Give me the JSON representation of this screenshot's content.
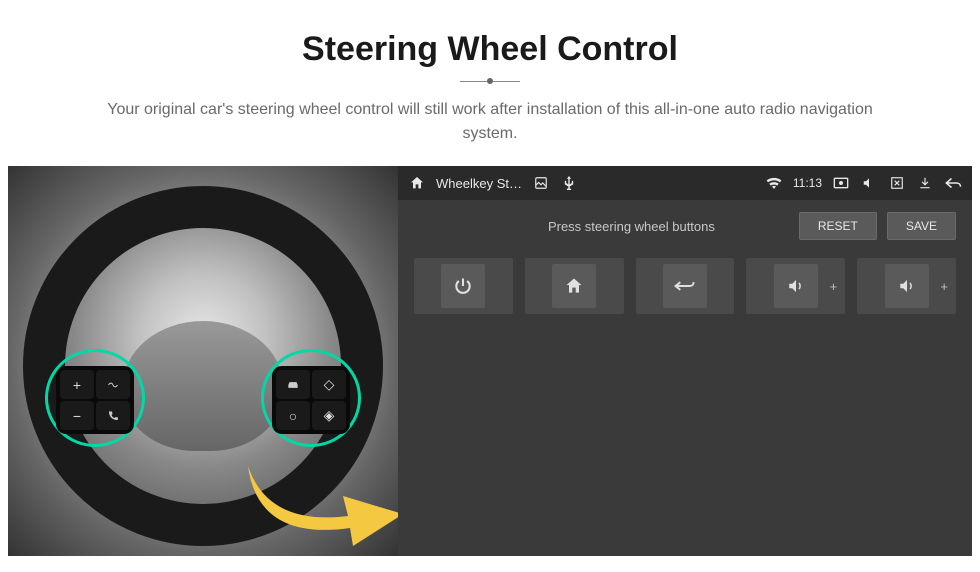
{
  "header": {
    "title": "Steering Wheel Control",
    "subtitle": "Your original car's steering wheel control will still work after installation of this all-in-one auto radio navigation system."
  },
  "wheel_buttons": {
    "left": [
      "plus-icon",
      "voice-icon",
      "minus-icon",
      "phone-icon"
    ],
    "right": [
      "car-icon",
      "diamond-icon",
      "circle-icon",
      "nav-icon"
    ]
  },
  "status_bar": {
    "app_title": "Wheelkey St…",
    "time": "11:13",
    "icons_left": [
      "home-icon",
      "picture-icon",
      "usb-icon"
    ],
    "icons_right": [
      "wifi-icon",
      "cast-icon",
      "mute-icon",
      "close-box-icon",
      "download-icon",
      "back-icon"
    ]
  },
  "config": {
    "instruction": "Press steering wheel buttons",
    "reset_label": "RESET",
    "save_label": "SAVE",
    "functions": [
      {
        "icon": "power-icon",
        "label": ""
      },
      {
        "icon": "home-icon",
        "label": ""
      },
      {
        "icon": "return-icon",
        "label": ""
      },
      {
        "icon": "volume-icon",
        "label": "+"
      },
      {
        "icon": "volume-icon",
        "label": "+"
      }
    ]
  },
  "colors": {
    "accent": "#00d9a6",
    "arrow": "#f5c842"
  }
}
